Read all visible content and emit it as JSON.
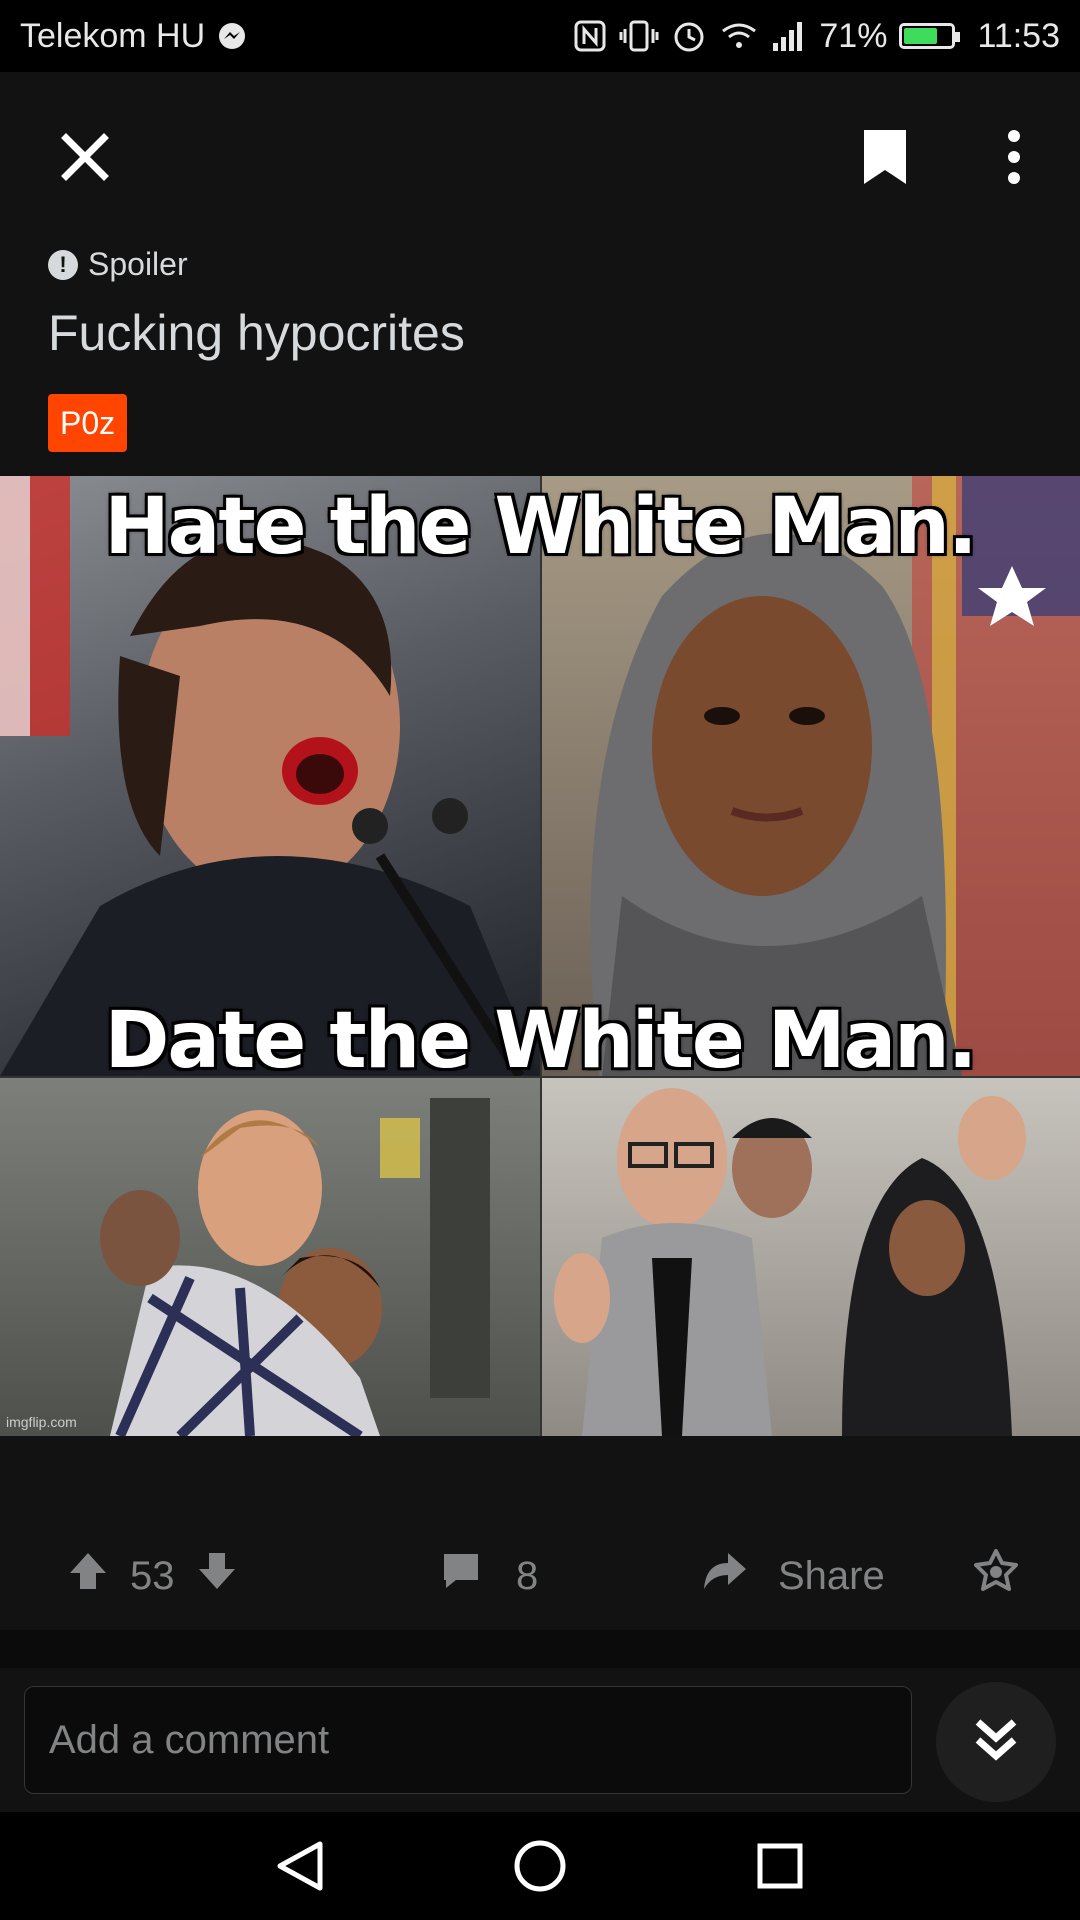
{
  "status_bar": {
    "carrier": "Telekom HU",
    "battery": "71%",
    "battery_level": 0.71,
    "time": "11:53",
    "icons": [
      "messenger-icon",
      "nfc-icon",
      "vibrate-icon",
      "alarm-icon",
      "wifi-icon",
      "signal-icon",
      "battery-icon"
    ]
  },
  "toolbar": {
    "icons": [
      "close-icon",
      "bookmark-icon",
      "more-options-icon"
    ]
  },
  "post": {
    "spoiler_label": "Spoiler",
    "title": "Fucking hypocrites",
    "flair": "P0z",
    "flair_color": "#ff4500",
    "image": {
      "caption_top": "Hate the White Man.",
      "caption_bottom": "Date the White Man.",
      "watermark": "imgflip.com"
    }
  },
  "actions": {
    "score": "53",
    "comments": "8",
    "share_label": "Share",
    "icons": [
      "upvote-icon",
      "downvote-icon",
      "comment-icon",
      "share-icon",
      "award-icon"
    ]
  },
  "comment": {
    "placeholder": "Add a comment"
  },
  "colors": {
    "background": "#121212",
    "text": "#d7dadc",
    "muted": "#818384",
    "accent": "#ff4500",
    "battery_green": "#3ddc5a"
  }
}
